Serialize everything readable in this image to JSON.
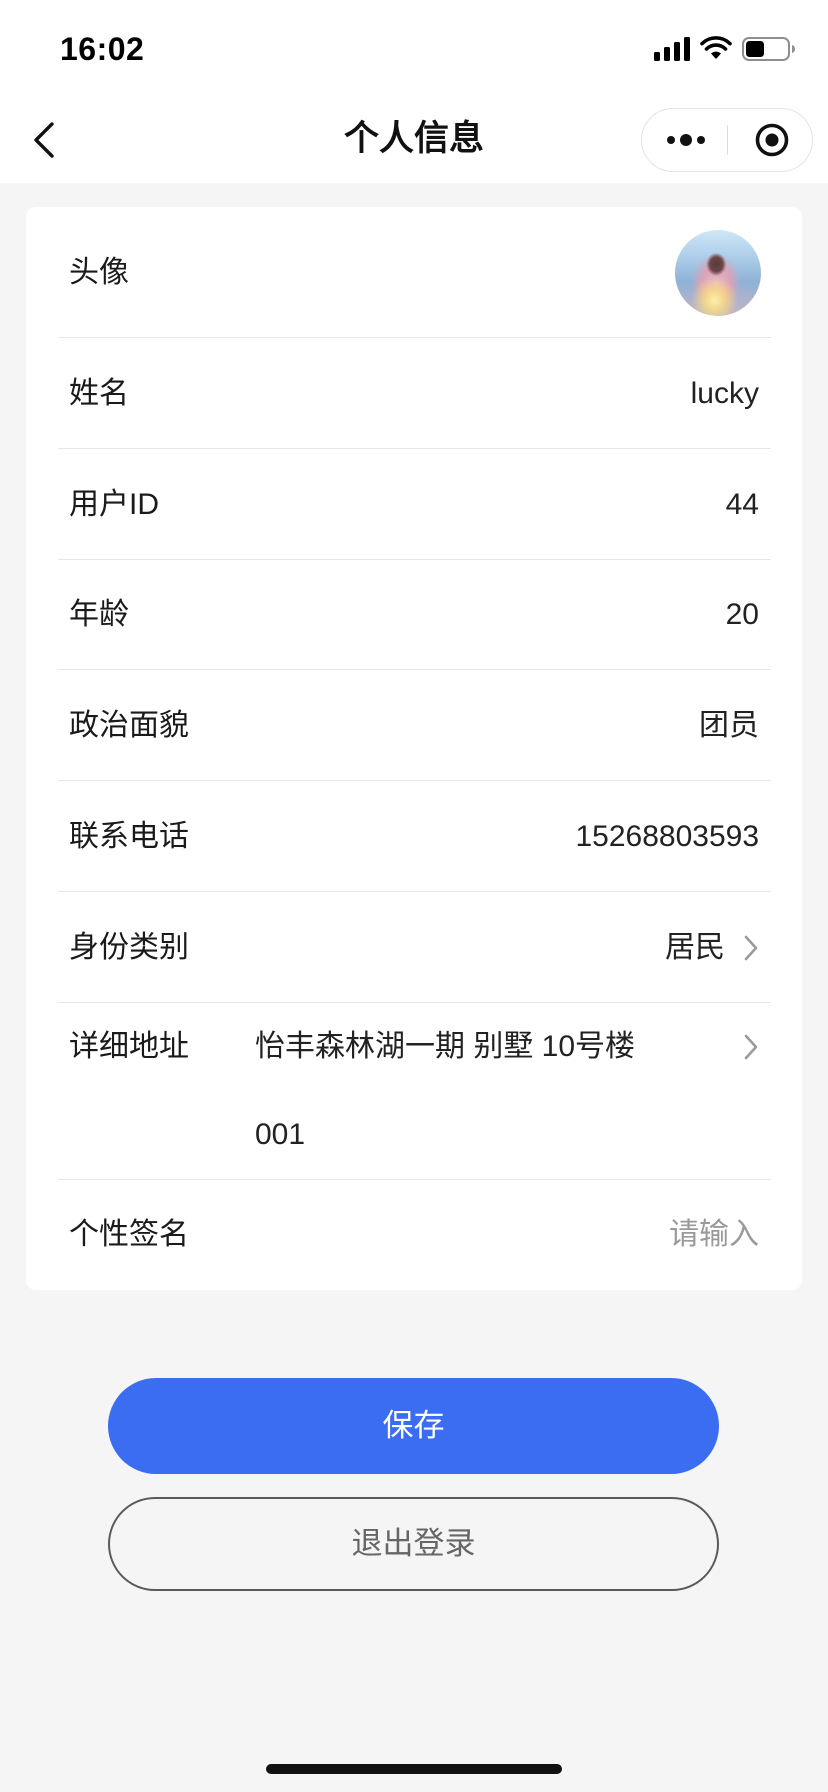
{
  "status_bar": {
    "time": "16:02",
    "battery_level": 0.45
  },
  "nav": {
    "title": "个人信息"
  },
  "fields": {
    "avatar": {
      "label": "头像"
    },
    "name": {
      "label": "姓名",
      "value": "lucky"
    },
    "user_id": {
      "label": "用户ID",
      "value": "44"
    },
    "age": {
      "label": "年龄",
      "value": "20"
    },
    "political_status": {
      "label": "政治面貌",
      "value": "团员"
    },
    "phone": {
      "label": "联系电话",
      "value": "15268803593"
    },
    "identity_type": {
      "label": "身份类别",
      "value": "居民"
    },
    "address": {
      "label": "详细地址",
      "value_lines": [
        "怡丰森林湖一期 别墅 10号楼",
        "001"
      ]
    },
    "signature": {
      "label": "个性签名",
      "value": "",
      "placeholder": "请输入"
    }
  },
  "buttons": {
    "save": "保存",
    "logout": "退出登录"
  },
  "icons": {
    "back": "chevron-left-icon",
    "more": "more-dots-icon",
    "close": "target-close-icon",
    "row_arrow": "chevron-right-icon",
    "signal": "cellular-signal-icon",
    "wifi": "wifi-icon",
    "battery": "battery-icon"
  },
  "colors": {
    "primary": "#3a6df2",
    "page_background": "#f5f5f5",
    "placeholder": "#9a9a9a"
  }
}
